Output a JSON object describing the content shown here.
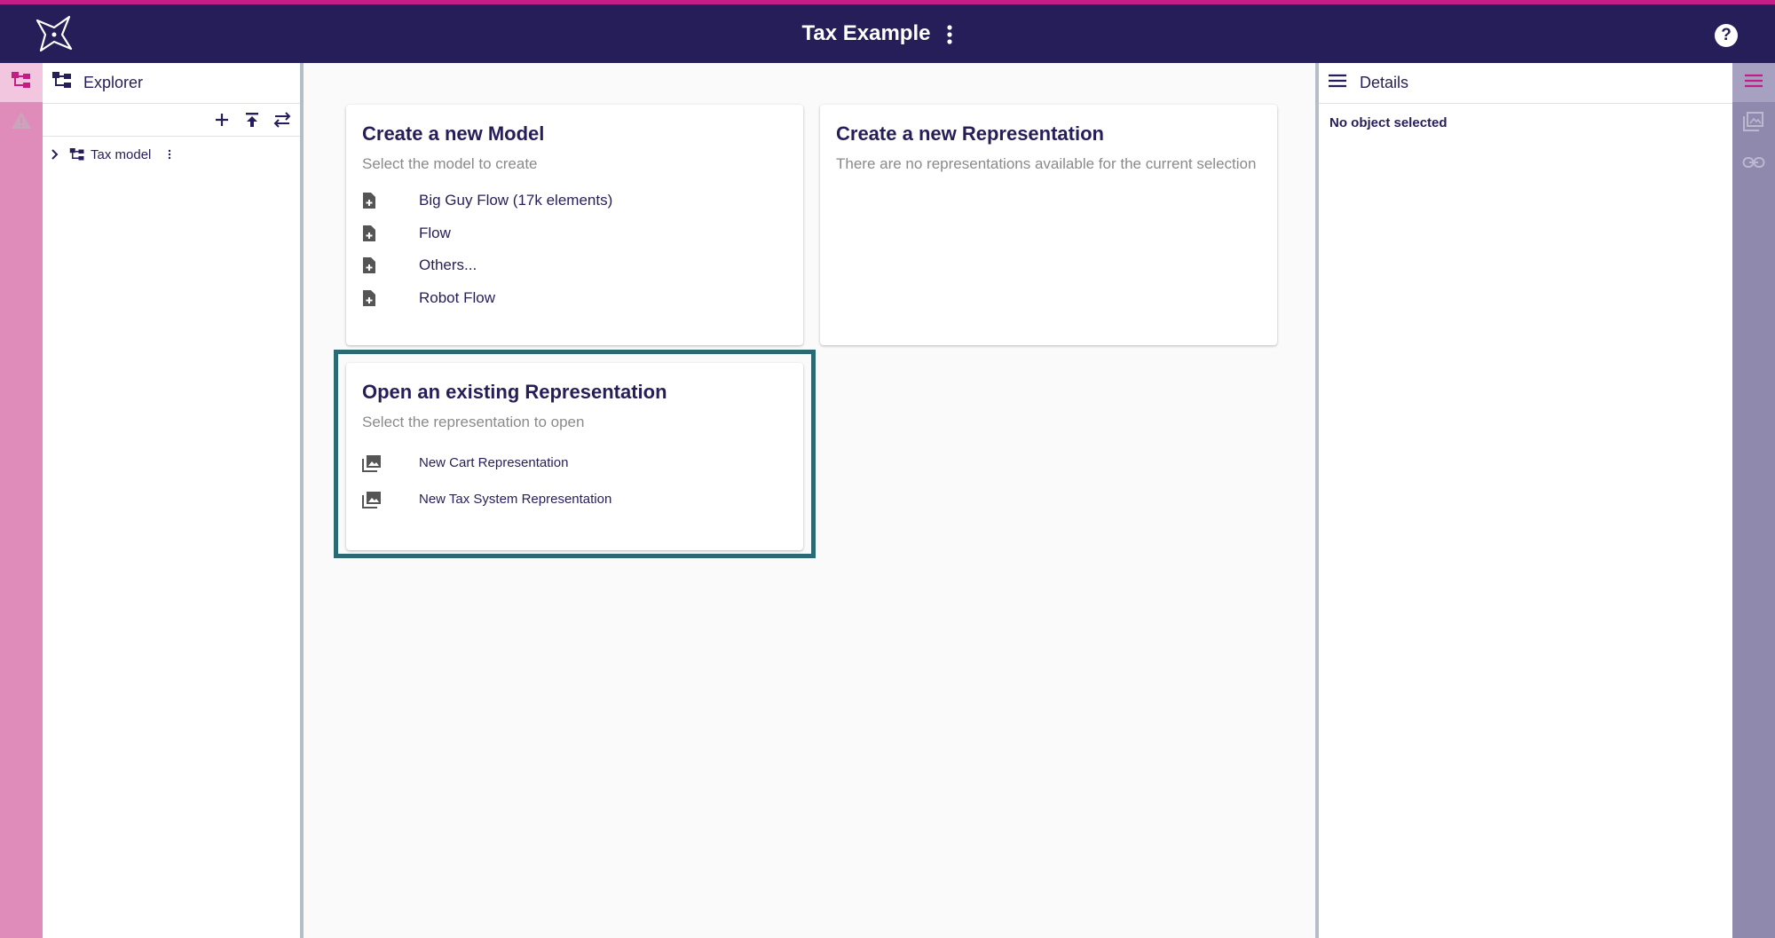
{
  "app": {
    "title": "Tax Example"
  },
  "icons": {
    "logo": "sirius-logo-icon",
    "title_menu": "more-vertical-icon",
    "help": "help-icon",
    "explorer": "explorer-tree-icon",
    "validation": "warning-icon",
    "new_model": "add-icon",
    "upload": "upload-icon",
    "sync": "swap-icon",
    "expand": "chevron-right-icon",
    "model": "model-tree-icon",
    "details": "menu-icon",
    "representations": "image-stack-icon",
    "related": "link-icon",
    "new_file": "note-add-icon",
    "representation": "collections-icon"
  },
  "explorer": {
    "title": "Explorer",
    "tree": [
      {
        "label": "Tax model"
      }
    ]
  },
  "cards": {
    "new_model": {
      "title": "Create a new Model",
      "subtitle": "Select the model to create",
      "items": [
        "Big Guy Flow (17k elements)",
        "Flow",
        "Others...",
        "Robot Flow"
      ]
    },
    "new_representation": {
      "title": "Create a new Representation",
      "subtitle": "There are no representations available for the current selection"
    },
    "open_representation": {
      "title": "Open an existing Representation",
      "subtitle": "Select the representation to open",
      "items": [
        "New Cart Representation",
        "New Tax System Representation"
      ]
    }
  },
  "details": {
    "title": "Details",
    "empty": "No object selected"
  },
  "colors": {
    "header": "#261e58",
    "accent": "#c41d86",
    "left_rail": "#df8cba",
    "right_rail": "#8f89ae",
    "focus": "#2b6a73"
  }
}
